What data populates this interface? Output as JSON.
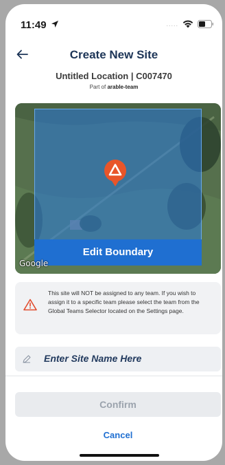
{
  "status_bar": {
    "time": "11:49",
    "signal": "....."
  },
  "header": {
    "title": "Create New Site",
    "back_icon": "back-arrow-icon"
  },
  "site": {
    "location_title": "Untitled Location | C007470",
    "part_of_prefix": "Part of ",
    "team_name": "arable-team"
  },
  "map": {
    "edit_boundary_label": "Edit Boundary",
    "google_label": "Google",
    "pin_icon": "location-pin-icon"
  },
  "notice": {
    "icon": "warning-icon",
    "text": "This site will NOT be assigned to any team. If you wish to assign it to a specific team please select the team from the Global Teams Selector located on the Settings page."
  },
  "site_name_input": {
    "placeholder": "Enter Site Name Here",
    "icon": "pencil-icon"
  },
  "actions": {
    "confirm_label": "Confirm",
    "cancel_label": "Cancel"
  },
  "colors": {
    "accent": "#1f6fd1",
    "title": "#1d3557",
    "pin": "#e8552a",
    "warning": "#e14b2d"
  }
}
